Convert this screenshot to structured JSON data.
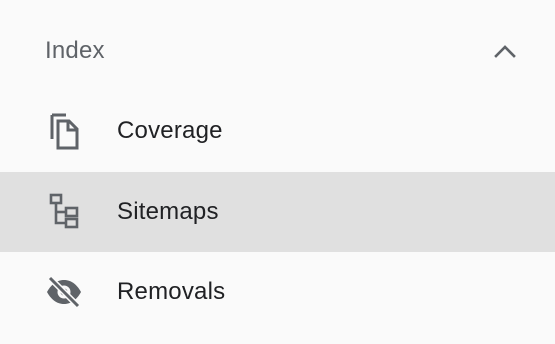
{
  "section": {
    "title": "Index",
    "expanded": true,
    "toggle_icon": "chevron-up-icon"
  },
  "items": [
    {
      "label": "Coverage",
      "icon": "copy-icon",
      "selected": false
    },
    {
      "label": "Sitemaps",
      "icon": "sitemap-icon",
      "selected": true
    },
    {
      "label": "Removals",
      "icon": "eye-off-icon",
      "selected": false
    }
  ],
  "colors": {
    "background": "#fafafa",
    "selected_background": "#e0e0e0",
    "header_text": "#5f6368",
    "item_text": "#202124",
    "icon": "#5f6368"
  }
}
